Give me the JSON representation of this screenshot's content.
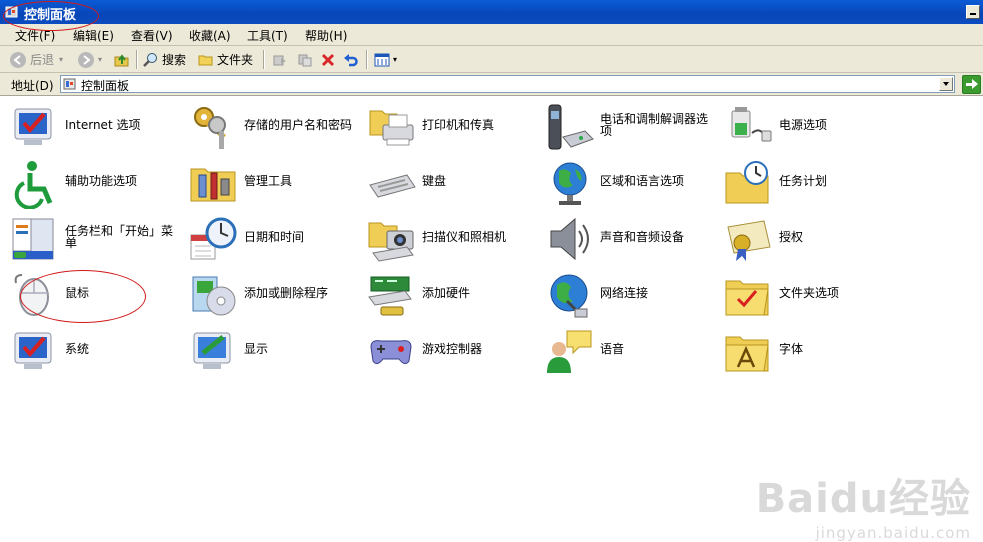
{
  "window": {
    "title": "控制面板"
  },
  "menu": [
    "文件(F)",
    "编辑(E)",
    "查看(V)",
    "收藏(A)",
    "工具(T)",
    "帮助(H)"
  ],
  "toolbar": {
    "back": "后退",
    "search": "搜索",
    "folders": "文件夹"
  },
  "address": {
    "label": "地址(D)",
    "value": "控制面板"
  },
  "items": [
    {
      "label": "Internet 选项",
      "icon": "internet-options-icon"
    },
    {
      "label": "存储的用户名和密码",
      "icon": "stored-credentials-icon"
    },
    {
      "label": "打印机和传真",
      "icon": "printer-icon"
    },
    {
      "label": "电话和调制解调器选项",
      "icon": "phone-modem-icon"
    },
    {
      "label": "电源选项",
      "icon": "power-options-icon"
    },
    {
      "label": "辅助功能选项",
      "icon": "accessibility-icon"
    },
    {
      "label": "管理工具",
      "icon": "admin-tools-icon"
    },
    {
      "label": "键盘",
      "icon": "keyboard-icon"
    },
    {
      "label": "区域和语言选项",
      "icon": "globe-icon"
    },
    {
      "label": "任务计划",
      "icon": "scheduled-tasks-icon"
    },
    {
      "label": "任务栏和「开始」菜单",
      "icon": "taskbar-icon"
    },
    {
      "label": "日期和时间",
      "icon": "clock-icon"
    },
    {
      "label": "扫描仪和照相机",
      "icon": "scanner-camera-icon"
    },
    {
      "label": "声音和音频设备",
      "icon": "speaker-icon"
    },
    {
      "label": "授权",
      "icon": "certificate-icon"
    },
    {
      "label": "鼠标",
      "icon": "mouse-icon"
    },
    {
      "label": "添加或删除程序",
      "icon": "add-remove-programs-icon"
    },
    {
      "label": "添加硬件",
      "icon": "add-hardware-icon"
    },
    {
      "label": "网络连接",
      "icon": "network-icon"
    },
    {
      "label": "文件夹选项",
      "icon": "folder-options-icon"
    },
    {
      "label": "系统",
      "icon": "system-icon"
    },
    {
      "label": "显示",
      "icon": "display-icon"
    },
    {
      "label": "游戏控制器",
      "icon": "gamepad-icon"
    },
    {
      "label": "语音",
      "icon": "speech-icon"
    },
    {
      "label": "字体",
      "icon": "fonts-folder-icon"
    }
  ],
  "watermark": {
    "logo": "Baidu经验",
    "url": "jingyan.baidu.com"
  },
  "colors": {
    "titlebar": "#0a5bd6",
    "chrome": "#ece9d8",
    "annotation": "#d21a1a"
  }
}
